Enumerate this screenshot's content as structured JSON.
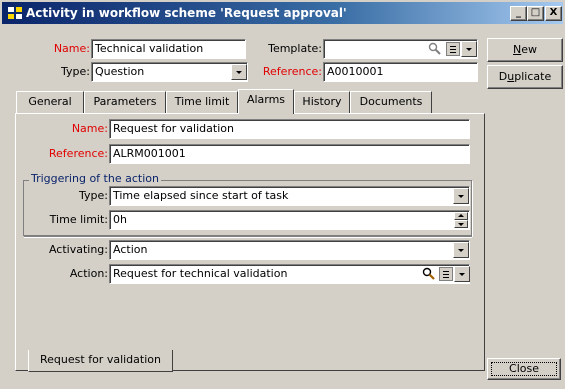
{
  "window": {
    "title": "Activity in workflow scheme 'Request approval'",
    "controls": {
      "minimize": "_",
      "maximize": "□",
      "close": "X"
    }
  },
  "header": {
    "name_label": "Name:",
    "name_value": "Technical validation",
    "template_label": "Template:",
    "template_value": "",
    "type_label": "Type:",
    "type_value": "Question",
    "reference_label": "Reference:",
    "reference_value": "A0010001"
  },
  "side_buttons": {
    "new_label": "New",
    "new_rest": "ew",
    "duplicate_prefix": "D",
    "duplicate_u": "u",
    "duplicate_rest": "plicate",
    "close_label": "Close"
  },
  "tabs": [
    {
      "label": "General"
    },
    {
      "label": "Parameters"
    },
    {
      "label": "Time limit"
    },
    {
      "label": "Alarms"
    },
    {
      "label": "History"
    },
    {
      "label": "Documents"
    }
  ],
  "active_tab": "Alarms",
  "alarm": {
    "name_label": "Name:",
    "name_value": "Request for validation",
    "reference_label": "Reference:",
    "reference_value": "ALRM001001",
    "triggering_group": "Triggering of the action",
    "type_label": "Type:",
    "type_value": "Time elapsed since start of task",
    "time_limit_label": "Time limit:",
    "time_limit_value": "0h",
    "activating_label": "Activating:",
    "activating_value": "Action",
    "action_label": "Action:",
    "action_value": "Request for technical validation"
  },
  "bottom_tab": {
    "label": "Request for validation"
  },
  "icons": {
    "title": "app-icon",
    "search": "magnifier-icon",
    "list": "list-icon",
    "dropdown": "chevron-down-icon"
  },
  "colors": {
    "titlebar_start": "#0a246a",
    "titlebar_end": "#a6caf0",
    "face": "#d4d0c8",
    "mandatory_label": "#e00000",
    "group_title": "#0a246a"
  }
}
